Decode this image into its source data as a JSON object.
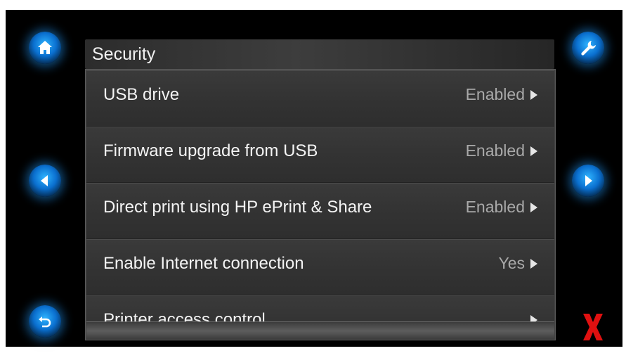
{
  "header": {
    "title": "Security"
  },
  "nav": {
    "home_icon": "home-icon",
    "settings_icon": "wrench-icon",
    "back_icon": "back-icon",
    "prev_icon": "arrow-left-icon",
    "next_icon": "arrow-right-icon",
    "cancel_icon": "red-x-icon"
  },
  "settings": {
    "items": [
      {
        "label": "USB drive",
        "value": "Enabled"
      },
      {
        "label": "Firmware upgrade from USB",
        "value": "Enabled"
      },
      {
        "label": "Direct print using HP ePrint & Share",
        "value": "Enabled"
      },
      {
        "label": "Enable Internet connection",
        "value": "Yes"
      },
      {
        "label": "Printer access control",
        "value": ""
      }
    ]
  },
  "colors": {
    "accent_blue": "#1a8ee8",
    "cancel_red": "#e01010",
    "background": "#000000"
  }
}
